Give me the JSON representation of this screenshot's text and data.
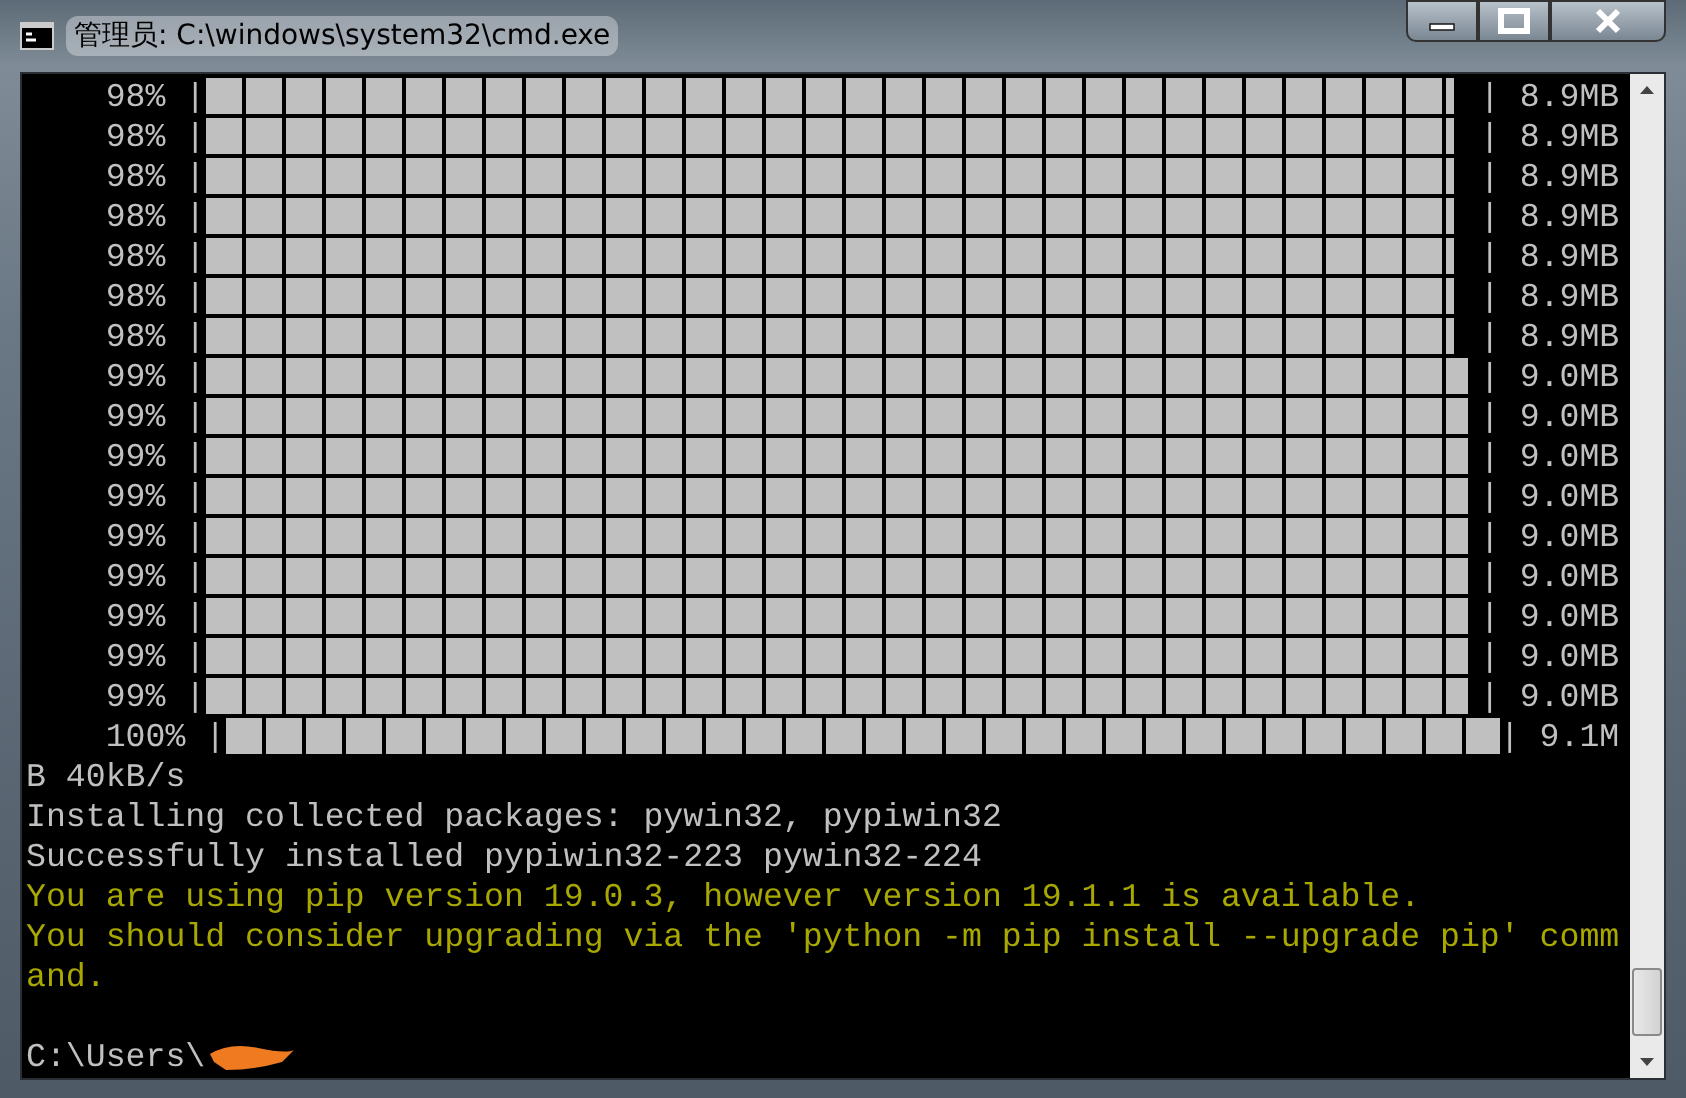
{
  "window": {
    "title": "管理员: C:\\windows\\system32\\cmd.exe"
  },
  "console": {
    "lines": [
      {
        "kind": "progress",
        "label": "98% |",
        "level": 0.98,
        "size": "| 8.9MB"
      },
      {
        "kind": "progress",
        "label": "98% |",
        "level": 0.98,
        "size": "| 8.9MB"
      },
      {
        "kind": "progress",
        "label": "98% |",
        "level": 0.98,
        "size": "| 8.9MB"
      },
      {
        "kind": "progress",
        "label": "98% |",
        "level": 0.98,
        "size": "| 8.9MB"
      },
      {
        "kind": "progress",
        "label": "98% |",
        "level": 0.98,
        "size": "| 8.9MB"
      },
      {
        "kind": "progress",
        "label": "98% |",
        "level": 0.98,
        "size": "| 8.9MB"
      },
      {
        "kind": "progress",
        "label": "98% |",
        "level": 0.98,
        "size": "| 8.9MB"
      },
      {
        "kind": "progress",
        "label": "99% |",
        "level": 0.99,
        "size": "| 9.0MB"
      },
      {
        "kind": "progress",
        "label": "99% |",
        "level": 0.99,
        "size": "| 9.0MB"
      },
      {
        "kind": "progress",
        "label": "99% |",
        "level": 0.99,
        "size": "| 9.0MB"
      },
      {
        "kind": "progress",
        "label": "99% |",
        "level": 0.99,
        "size": "| 9.0MB"
      },
      {
        "kind": "progress",
        "label": "99% |",
        "level": 0.99,
        "size": "| 9.0MB"
      },
      {
        "kind": "progress",
        "label": "99% |",
        "level": 0.99,
        "size": "| 9.0MB"
      },
      {
        "kind": "progress",
        "label": "99% |",
        "level": 0.99,
        "size": "| 9.0MB"
      },
      {
        "kind": "progress",
        "label": "99% |",
        "level": 0.99,
        "size": "| 9.0MB"
      },
      {
        "kind": "progress",
        "label": "99% |",
        "level": 0.99,
        "size": "| 9.0MB"
      },
      {
        "kind": "progress",
        "label": "100% |",
        "level": 1,
        "size": "| 9.1M"
      },
      {
        "kind": "output",
        "text": "B 40kB/s"
      },
      {
        "kind": "output",
        "text": "Installing collected packages: pywin32, pypiwin32"
      },
      {
        "kind": "output",
        "text": "Successfully installed pypiwin32-223 pywin32-224"
      },
      {
        "kind": "warning",
        "text": "You are using pip version 19.0.3, however version 19.1.1 is available."
      },
      {
        "kind": "warning",
        "text": "You should consider upgrading via the 'python -m pip install --upgrade pip' comm"
      },
      {
        "kind": "warning",
        "text": "and."
      },
      {
        "kind": "blank"
      },
      {
        "kind": "prompt",
        "text": "C:\\Users\\"
      }
    ]
  }
}
